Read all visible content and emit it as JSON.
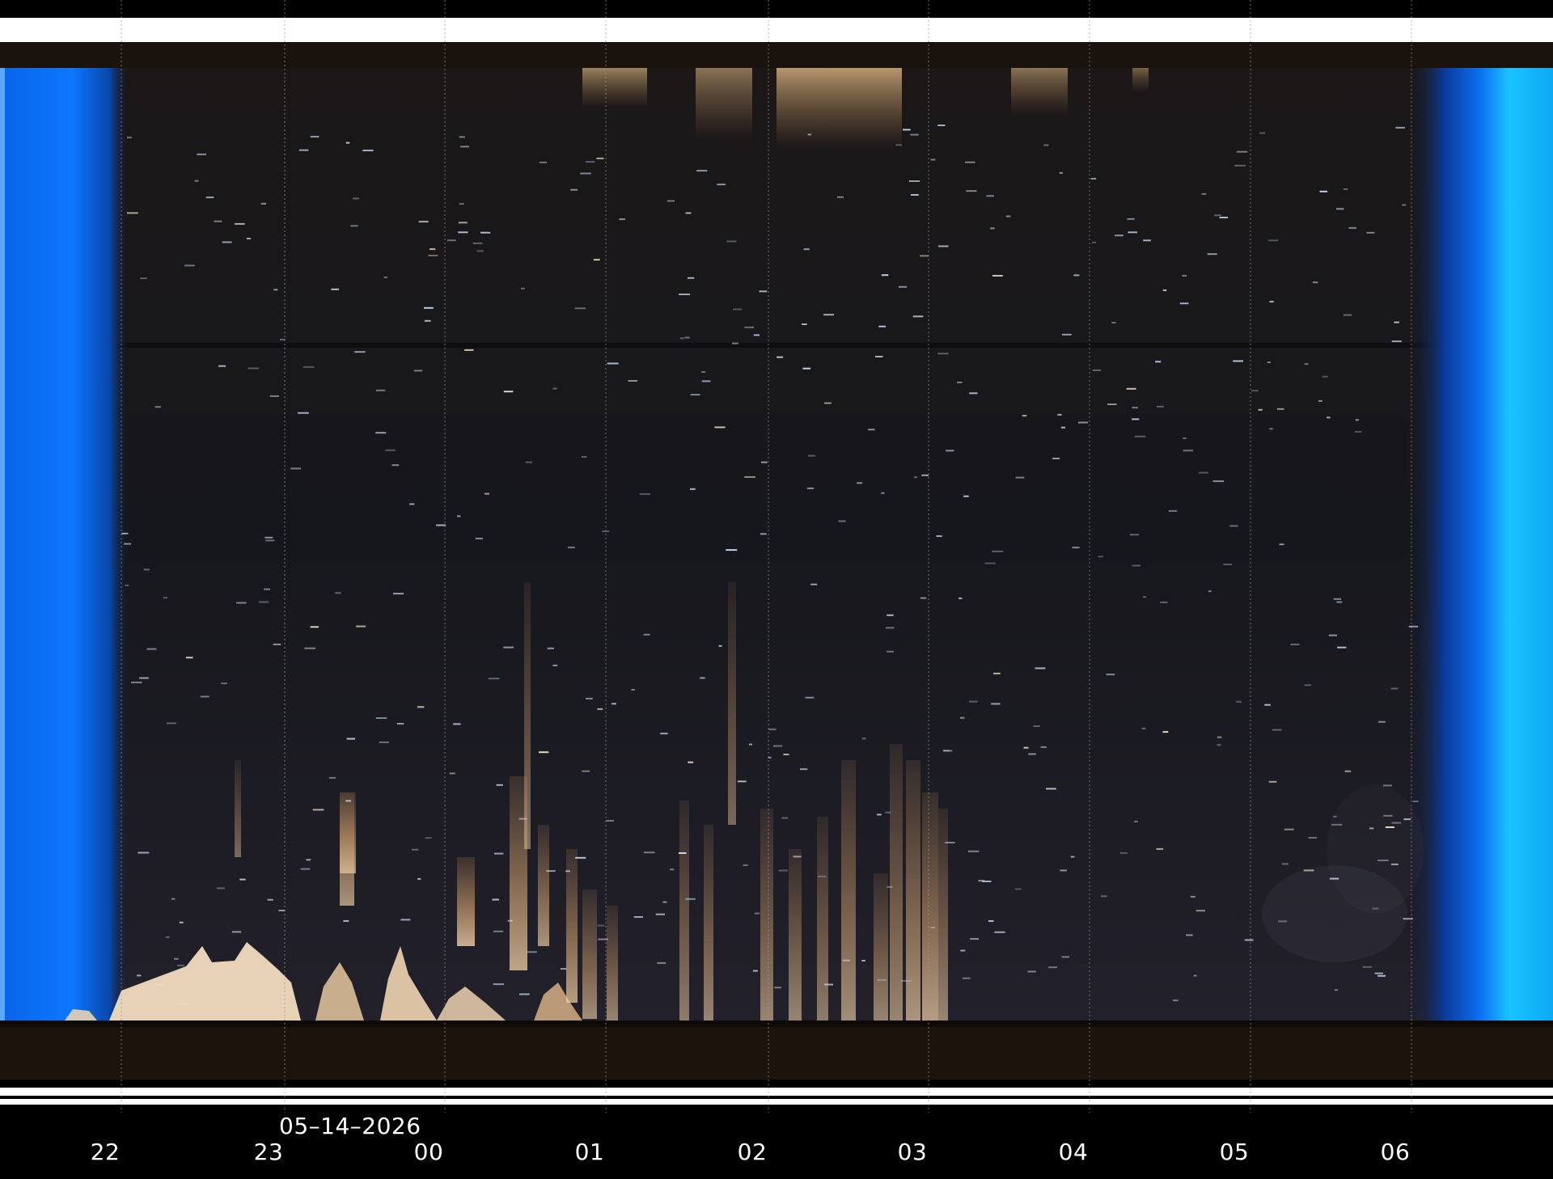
{
  "image": {
    "kind": "keogram",
    "description_colors": {
      "twilight": "#0a7bff",
      "twilight_bright": "#17c8ff",
      "sky": "#1c1b1f",
      "cloud": "#e3b98a",
      "band": "#ffffff"
    }
  },
  "axis": {
    "date": "05–14–2026",
    "hours": [
      "22",
      "23",
      "00",
      "01",
      "02",
      "03",
      "04",
      "05",
      "06"
    ]
  }
}
